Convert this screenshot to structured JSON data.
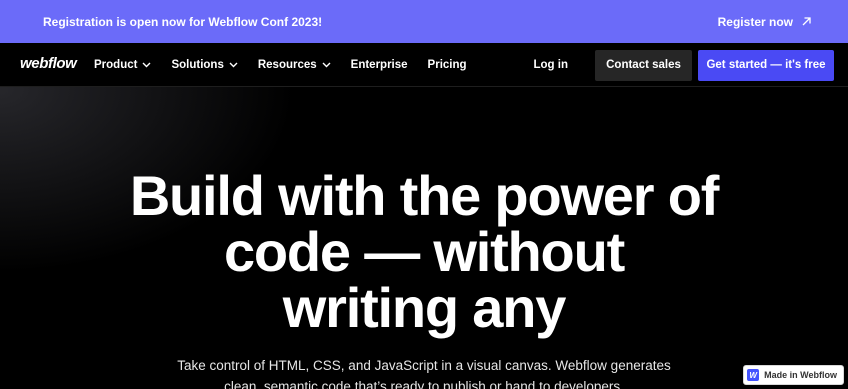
{
  "banner": {
    "text": "Registration is open now for Webflow Conf 2023!",
    "cta_label": "Register now",
    "bg_color": "#6b6bf9",
    "cta_icon": "arrow-up-right-icon"
  },
  "nav": {
    "logo": "webflow",
    "items": [
      {
        "label": "Product",
        "has_dropdown": true
      },
      {
        "label": "Solutions",
        "has_dropdown": true
      },
      {
        "label": "Resources",
        "has_dropdown": true
      },
      {
        "label": "Enterprise",
        "has_dropdown": false
      },
      {
        "label": "Pricing",
        "has_dropdown": false
      }
    ],
    "login_label": "Log in",
    "contact_label": "Contact sales",
    "start_label": "Get started — it's free",
    "start_color": "#4a4af4"
  },
  "hero": {
    "title_lines": [
      "Build with the power of",
      "code — without",
      "writing any"
    ],
    "subtitle_lines": [
      "Take control of HTML, CSS, and JavaScript in a visual canvas. Webflow generates",
      "clean, semantic code that’s ready to publish or hand to developers."
    ]
  },
  "badge": {
    "icon_letter": "W",
    "label": "Made in Webflow"
  }
}
